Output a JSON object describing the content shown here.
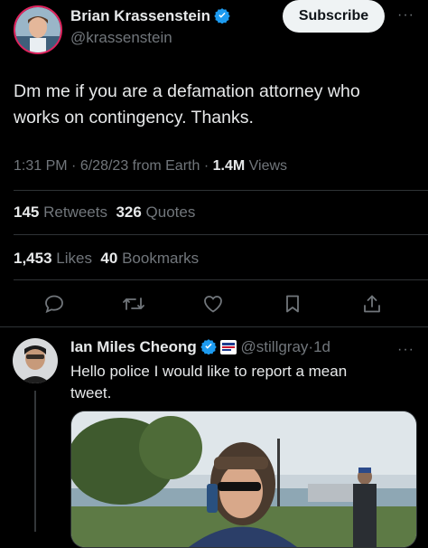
{
  "main_tweet": {
    "author_name": "Brian Krassenstein",
    "author_handle": "@krassenstein",
    "subscribe_label": "Subscribe",
    "more_label": "···",
    "text": "Dm me if you are a defamation attorney who works on contingency. Thanks.",
    "time": "1:31 PM",
    "sep1": "·",
    "date": "6/28/23",
    "source": "from Earth",
    "sep2": "·",
    "views_count": "1.4M",
    "views_label": "Views",
    "retweets_count": "145",
    "retweets_label": "Retweets",
    "quotes_count": "326",
    "quotes_label": "Quotes",
    "likes_count": "1,453",
    "likes_label": "Likes",
    "bookmarks_count": "40",
    "bookmarks_label": "Bookmarks"
  },
  "actions": {
    "icons": [
      "reply-icon",
      "retweet-icon",
      "like-icon",
      "bookmark-icon",
      "share-icon"
    ]
  },
  "reply": {
    "author_name": "Ian Miles Cheong",
    "author_handle": "@stillgray",
    "sep": "·",
    "age": "1d",
    "more_label": "···",
    "text": "Hello police I would like to report a mean tweet."
  },
  "colors": {
    "background": "#000000",
    "text": "#e7e9ea",
    "secondary": "#71767b",
    "verified_blue": "#1d9bf0",
    "divider": "#2f3336"
  }
}
